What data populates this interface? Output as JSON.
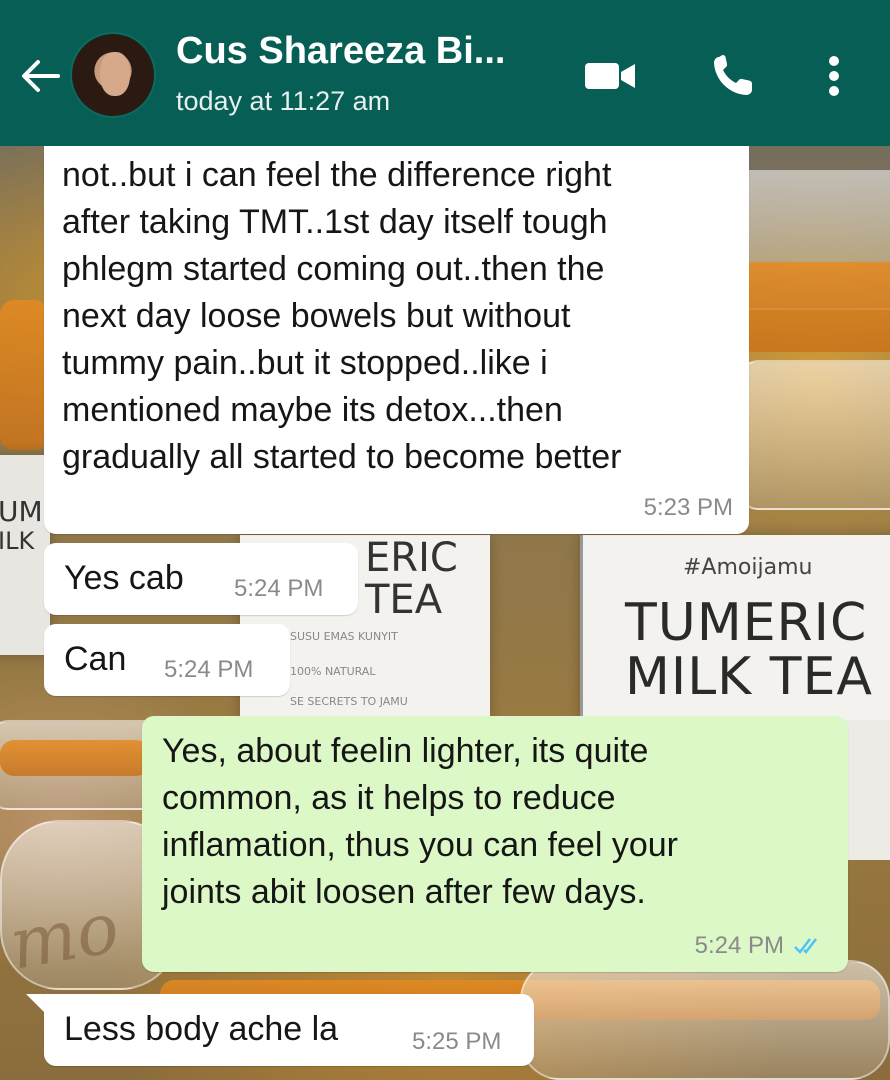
{
  "header": {
    "contact_name": "Cus Shareeza Bi...",
    "status": "today at 11:27 am",
    "bar_color": "#075e54",
    "icons": {
      "back": "arrow-left-icon",
      "video": "video-camera-icon",
      "call": "phone-icon",
      "menu": "more-vertical-icon"
    }
  },
  "wallpaper": {
    "hashtag": "#Amoijamu",
    "big_label_line1": "TUMERIC",
    "big_label_line2": "MILK TEA",
    "mid_label_line1": "ERIC",
    "mid_label_line2": "TEA",
    "mid_small1": "SUSU EMAS KUNYIT",
    "mid_small2": "100% NATURAL",
    "mid_small3": "SE SECRETS TO JAMU",
    "left_frag1": "UM",
    "left_frag2": "ILK",
    "lid_script": "mo"
  },
  "messages": [
    {
      "direction": "incoming",
      "lines": [
        "not..but i can feel the difference right",
        "after taking TMT..1st day itself tough",
        "phlegm started coming out..then the",
        "next day loose bowels but without",
        "tummy pain..but it stopped..like i",
        "mentioned maybe its detox...then",
        "gradually all started to become better"
      ],
      "time": "5:23 PM"
    },
    {
      "direction": "incoming",
      "text": "Yes cab",
      "time": "5:24 PM"
    },
    {
      "direction": "incoming",
      "text": "Can",
      "time": "5:24 PM"
    },
    {
      "direction": "outgoing",
      "lines": [
        "Yes, about feelin lighter, its quite",
        "common, as it helps to reduce",
        "inflamation, thus you can feel your",
        "joints abit loosen after few days."
      ],
      "time": "5:24 PM",
      "status_icon": "double-check-icon",
      "status_color": "#4fc3f7"
    },
    {
      "direction": "incoming",
      "text": "Less body ache la",
      "time": "5:25 PM"
    }
  ]
}
